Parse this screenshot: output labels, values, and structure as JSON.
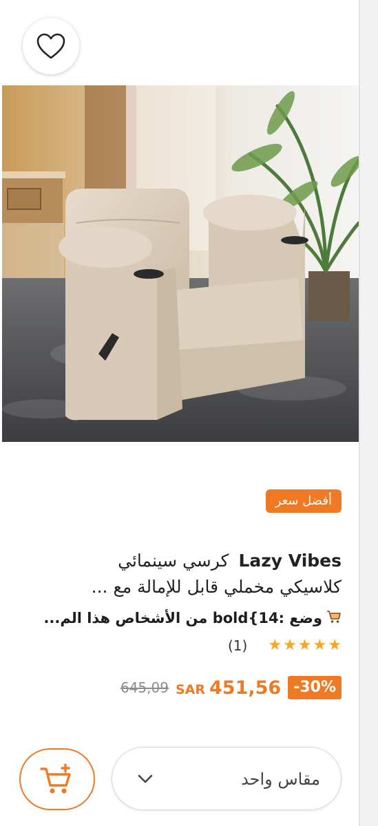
{
  "product": {
    "best_price_badge": "أفضل سعر",
    "brand": "Lazy Vibes",
    "title_line1": "كرسي سينمائي",
    "title_line2": "كلاسيكي مخملي قابل للإمالة مع ...",
    "meta_text": "وضع :bold{14 من الأشخاص هذا الم...",
    "rating": {
      "stars": 5,
      "count": "(1)"
    },
    "price": {
      "discount": "-30%",
      "currency": "SAR",
      "amount": "451,56",
      "old_amount": "645,09"
    }
  },
  "actions": {
    "size_label": "مقاس واحد"
  },
  "icons": {
    "wishlist": "heart-icon",
    "cart": "cart-plus-icon",
    "chevron": "chevron-down-icon",
    "meta": "cart-icon"
  },
  "colors": {
    "accent": "#f07a24",
    "star": "#f5a623",
    "text": "#222222"
  }
}
